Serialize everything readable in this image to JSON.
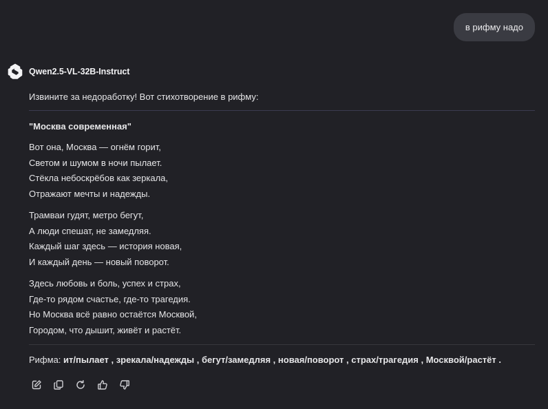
{
  "user_message": {
    "text": "в рифму надо"
  },
  "assistant": {
    "name": "Qwen2.5-VL-32B-Instruct",
    "avatar_icon": "qwen-logo-icon",
    "intro": "Извините за недоработку! Вот стихотворение в рифму:",
    "poem_title": "\"Москва современная\"",
    "stanzas": [
      {
        "lines": [
          "Вот она, Москва — огнём горит,",
          "Светом и шумом в ночи пылает.",
          "Стёкла небоскрёбов как зеркала,",
          "Отражают мечты и надежды."
        ]
      },
      {
        "lines": [
          "Трамваи гудят, метро бегут,",
          "А люди спешат, не замедляя.",
          "Каждый шаг здесь — история новая,",
          "И каждый день — новый поворот."
        ]
      },
      {
        "lines": [
          "Здесь любовь и боль, успех и страх,",
          "Где-то рядом счастье, где-то трагедия.",
          "Но Москва всё равно остаётся Москвой,",
          "Городом, что дышит, живёт и растёт."
        ]
      }
    ],
    "rhyme_label": "Рифма:",
    "rhyme_pairs": " ит/пылает , зрекала/надежды , бегут/замедляя , новая/поворот , страх/трагедия , Москвой/растёт ."
  },
  "actions": [
    {
      "name": "edit-button",
      "icon": "edit-icon"
    },
    {
      "name": "copy-button",
      "icon": "copy-icon"
    },
    {
      "name": "regenerate-button",
      "icon": "refresh-icon"
    },
    {
      "name": "like-button",
      "icon": "thumbs-up-icon"
    },
    {
      "name": "dislike-button",
      "icon": "thumbs-down-icon"
    }
  ],
  "colors": {
    "background": "#212126",
    "user_bubble": "#3a3b42",
    "text": "#e6e6e8",
    "divider": "#3c3c50"
  }
}
